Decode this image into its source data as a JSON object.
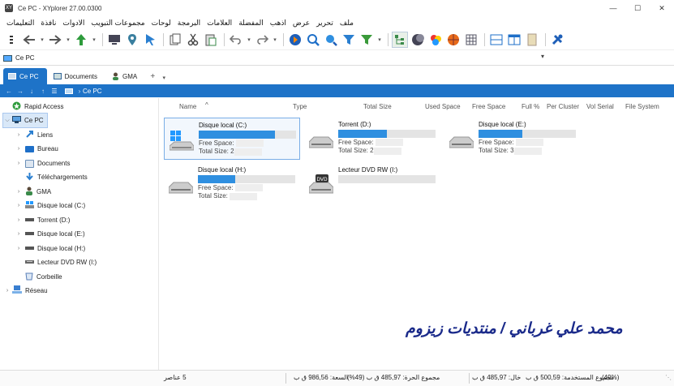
{
  "window": {
    "title": "Ce PC - XYplorer 27.00.0300",
    "minimize": "—",
    "maximize": "☐",
    "close": "✕"
  },
  "menu": [
    "ملف",
    "تحرير",
    "عرض",
    "اذهب",
    "المفضلة",
    "العلامات",
    "البرمجة",
    "لوحات",
    "مجموعات التبويب",
    "الادوات",
    "نافذة",
    "التعليمات"
  ],
  "toolbar": {
    "icons": [
      "menu-icon",
      "back-icon",
      "forward-icon",
      "up-icon",
      "computer-icon",
      "location-icon",
      "pointer-icon",
      "copy-icon",
      "cut-icon",
      "paste-icon",
      "undo-icon",
      "redo-icon",
      "find-icon",
      "search-icon",
      "zoom-icon",
      "filter-icon",
      "filter-green-icon",
      "tree-icon",
      "moon-icon",
      "colors-icon",
      "ball-icon",
      "grid-icon",
      "panel-icon",
      "dual-pane-icon",
      "preview-icon",
      "tools-icon"
    ]
  },
  "address": {
    "text": "Ce PC"
  },
  "tabs": [
    {
      "label": "Ce PC",
      "active": true
    },
    {
      "label": "Documents",
      "active": false
    },
    {
      "label": "GMA",
      "active": false
    }
  ],
  "nav": {
    "crumb": "Ce PC"
  },
  "tree": {
    "items": [
      {
        "label": "Rapid Access",
        "icon": "star-icon",
        "color": "#2e9b3c"
      },
      {
        "label": "Ce PC",
        "icon": "computer-icon",
        "color": "#4a8fd8"
      },
      {
        "label": "Liens",
        "icon": "link-icon",
        "color": "#2a7fd0"
      },
      {
        "label": "Bureau",
        "icon": "desktop-icon",
        "color": "#1e6fc8"
      },
      {
        "label": "Documents",
        "icon": "documents-icon",
        "color": "#6a8fb8"
      },
      {
        "label": "Téléchargements",
        "icon": "download-icon",
        "color": "#2a7fd0"
      },
      {
        "label": "GMA",
        "icon": "user-icon",
        "color": "#3a8a4a"
      },
      {
        "label": "Disque local (C:)",
        "icon": "drive-c-icon",
        "color": "#5aa0e0"
      },
      {
        "label": "Torrent (D:)",
        "icon": "drive-icon",
        "color": "#555555"
      },
      {
        "label": "Disque local (E:)",
        "icon": "drive-icon",
        "color": "#555555"
      },
      {
        "label": "Disque local  (H:)",
        "icon": "drive-icon",
        "color": "#555555"
      },
      {
        "label": "Lecteur DVD RW (I:)",
        "icon": "dvd-icon",
        "color": "#666666"
      },
      {
        "label": "Corbeille",
        "icon": "recycle-icon",
        "color": "#5a7fb8"
      },
      {
        "label": "Réseau",
        "icon": "network-icon",
        "color": "#3a7fd0"
      }
    ]
  },
  "columns": [
    "Name",
    "Type",
    "Total Size",
    "Used Space",
    "Free Space",
    "Full %",
    "Per Cluster",
    "Vol Serial",
    "File System"
  ],
  "drives": [
    {
      "name": "Disque local (C:)",
      "free_label": "Free Space:",
      "total_label": "Total Size:",
      "total_prefix": "2",
      "used_fraction": 0.78
    },
    {
      "name": "Torrent (D:)",
      "free_label": "Free Space:",
      "total_label": "Total Size:",
      "total_prefix": "2",
      "used_fraction": 0.5
    },
    {
      "name": "Disque local (E:)",
      "free_label": "Free Space:",
      "total_label": "Total Size:",
      "total_prefix": "3",
      "used_fraction": 0.45
    },
    {
      "name": "Disque local  (H:)",
      "free_label": "Free Space:",
      "total_label": "Total Size:",
      "total_prefix": "",
      "used_fraction": 0.38
    },
    {
      "name": "Lecteur DVD RW (I:)",
      "free_label": "",
      "total_label": "",
      "total_prefix": "",
      "used_fraction": 0
    }
  ],
  "watermark": "محمد علي غرباني / منتديات زيزوم",
  "status": {
    "items_count": "5 عناصر",
    "capacity": "السعة: 986,56 ق ب",
    "free_total": "مجموع الحرة: 485,97 ق ب (49%)",
    "free": "خال: 485,97 ق ب",
    "used_total": "مجموع المستخدمة: 500,59 ق ب",
    "used_percent": "(49%)"
  },
  "colors": {
    "accent": "#1e73c8",
    "bar_fill": "#2f8fe0",
    "watermark": "#1a2a8a"
  }
}
